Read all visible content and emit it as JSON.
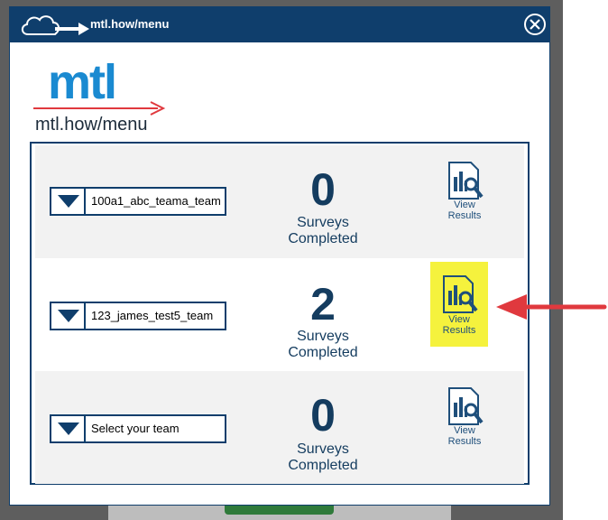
{
  "window": {
    "title": "mtl.how/menu"
  },
  "logo": {
    "word": "mtl",
    "subtitle": "mtl.how/menu"
  },
  "teams": [
    {
      "name": "100a1_abc_teama_team",
      "count": "0",
      "label_line1": "Surveys",
      "label_line2": "Completed",
      "results_line1": "View",
      "results_line2": "Results"
    },
    {
      "name": "123_james_test5_team",
      "count": "2",
      "label_line1": "Surveys",
      "label_line2": "Completed",
      "results_line1": "View",
      "results_line2": "Results"
    },
    {
      "name": "Select your team",
      "count": "0",
      "label_line1": "Surveys",
      "label_line2": "Completed",
      "results_line1": "View",
      "results_line2": "Results"
    }
  ],
  "icons": {
    "title": "cloud-arrow-icon",
    "close": "close-circle-x-icon",
    "dropdown": "triangle-down-icon",
    "results": "document-chart-magnifier-icon",
    "annotation": "red-arrow-left"
  },
  "colors": {
    "header": "#0f3e6c",
    "logo": "#1a8ad1",
    "accent_red": "#e0393e",
    "highlight": "#f5f23d",
    "count": "#143c5f"
  }
}
